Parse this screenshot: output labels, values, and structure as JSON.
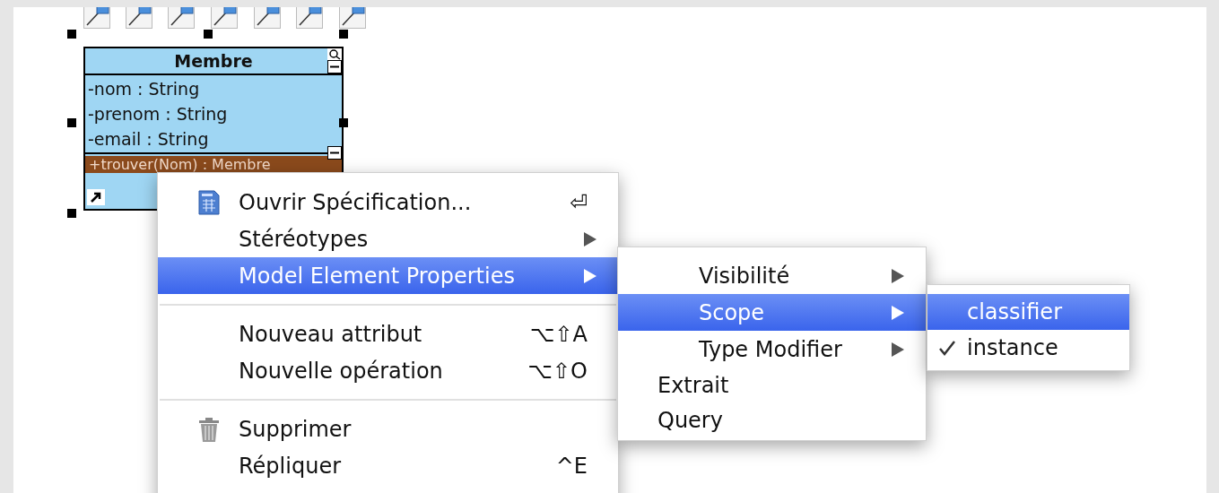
{
  "diagram": {
    "class": {
      "name": "Membre",
      "attributes": [
        "-nom : String",
        "-prenom : String",
        "-email : String"
      ],
      "operations": [
        {
          "text": "+trouver(Nom) : Membre",
          "selected": true
        }
      ]
    }
  },
  "context_menu": {
    "items": [
      {
        "kind": "item",
        "label": "Ouvrir Spécification...",
        "shortcut": "⏎",
        "submenu": false,
        "selected": false
      },
      {
        "kind": "item",
        "label": "Stéréotypes",
        "submenu": true,
        "selected": false
      },
      {
        "kind": "item",
        "label": "Model Element Properties",
        "submenu": true,
        "selected": true
      },
      {
        "kind": "separator"
      },
      {
        "kind": "item",
        "label": "Nouveau attribut",
        "shortcut": "⌥⇧A",
        "submenu": false,
        "selected": false
      },
      {
        "kind": "item",
        "label": "Nouvelle opération",
        "shortcut": "⌥⇧O",
        "submenu": false,
        "selected": false
      },
      {
        "kind": "separator"
      },
      {
        "kind": "item",
        "label": "Supprimer",
        "submenu": false,
        "selected": false
      },
      {
        "kind": "item",
        "label": "Répliquer",
        "shortcut": "^E",
        "submenu": false,
        "selected": false
      }
    ]
  },
  "submenu": {
    "items": [
      {
        "kind": "nested",
        "label": "Visibilité",
        "submenu": true,
        "selected": false
      },
      {
        "kind": "nested",
        "label": "Scope",
        "submenu": true,
        "selected": true
      },
      {
        "kind": "nested",
        "label": "Type Modifier",
        "submenu": true,
        "selected": false
      },
      {
        "kind": "plain",
        "label": "Extrait",
        "submenu": false,
        "selected": false
      },
      {
        "kind": "plain",
        "label": "Query",
        "submenu": false,
        "selected": false
      }
    ]
  },
  "scope_menu": {
    "items": [
      {
        "label": "classifier",
        "checked": false,
        "selected": true
      },
      {
        "label": "instance",
        "checked": true,
        "selected": false
      }
    ]
  }
}
